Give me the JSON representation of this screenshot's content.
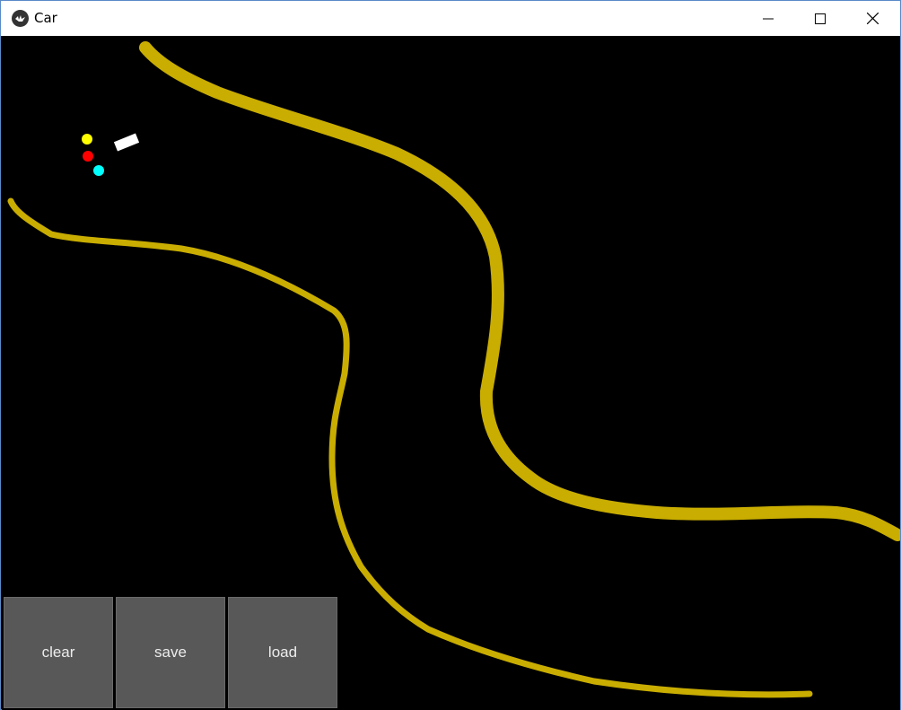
{
  "window": {
    "title": "Car",
    "icons": {
      "app": "kivy-app-icon",
      "minimize": "minimize-icon",
      "maximize": "maximize-icon",
      "close": "close-icon"
    }
  },
  "scene": {
    "background": "#000000",
    "sand_color": "#c9ad00",
    "car_color": "#ffffff",
    "sensor_colors": {
      "sensor1": "#ffff00",
      "sensor2": "#ff0000",
      "sensor3": "#00ffff"
    }
  },
  "controls": {
    "clear_label": "clear",
    "save_label": "save",
    "load_label": "load",
    "button_color": "#585858"
  }
}
